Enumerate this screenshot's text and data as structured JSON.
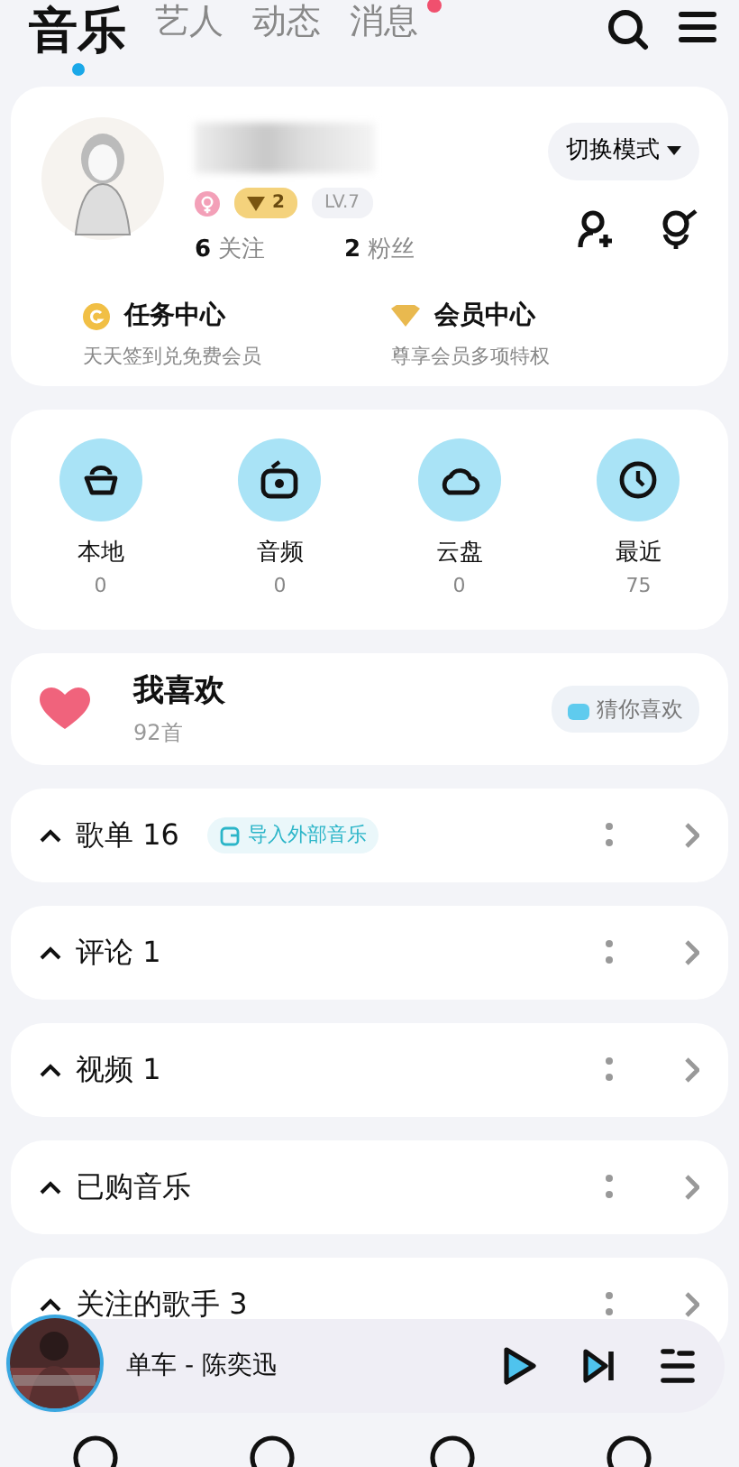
{
  "tabs": [
    {
      "label": "音乐",
      "selected": true,
      "unread": false
    },
    {
      "label": "艺人",
      "selected": false,
      "unread": false
    },
    {
      "label": "动态",
      "selected": false,
      "unread": false
    },
    {
      "label": "消息",
      "selected": false,
      "unread": true
    }
  ],
  "profile": {
    "badges": [
      {
        "kind": "gender"
      },
      {
        "kind": "vip",
        "text": "2"
      },
      {
        "kind": "level",
        "text": "LV.7"
      }
    ],
    "stats": [
      {
        "value": "6",
        "label": "关注"
      },
      {
        "value": "2",
        "label": "粉丝"
      }
    ],
    "mode_button": "切换模式",
    "links": [
      {
        "kind": "task",
        "title": "任务中心",
        "subtitle": "天天签到兑免费会员"
      },
      {
        "kind": "vip",
        "title": "会员中心",
        "subtitle": "尊享会员多项特权"
      }
    ]
  },
  "quick": [
    {
      "kind": "local",
      "label": "本地",
      "count": "0"
    },
    {
      "kind": "audio",
      "label": "音频",
      "count": "0"
    },
    {
      "kind": "cloud",
      "label": "云盘",
      "count": "0"
    },
    {
      "kind": "recent",
      "label": "最近",
      "count": "75"
    }
  ],
  "favorites": {
    "title": "我喜欢",
    "count": "92首",
    "button": "猜你喜欢"
  },
  "sections": [
    {
      "title": "歌单 16",
      "expanded": true,
      "action": "导入外部音乐"
    },
    {
      "title": "评论 1",
      "expanded": true
    },
    {
      "title": "视频 1",
      "expanded": true
    },
    {
      "title": "已购音乐",
      "expanded": true
    },
    {
      "title": "关注的歌手 3",
      "expanded": true
    }
  ],
  "player": {
    "track": "单车 - 陈奕迅"
  }
}
